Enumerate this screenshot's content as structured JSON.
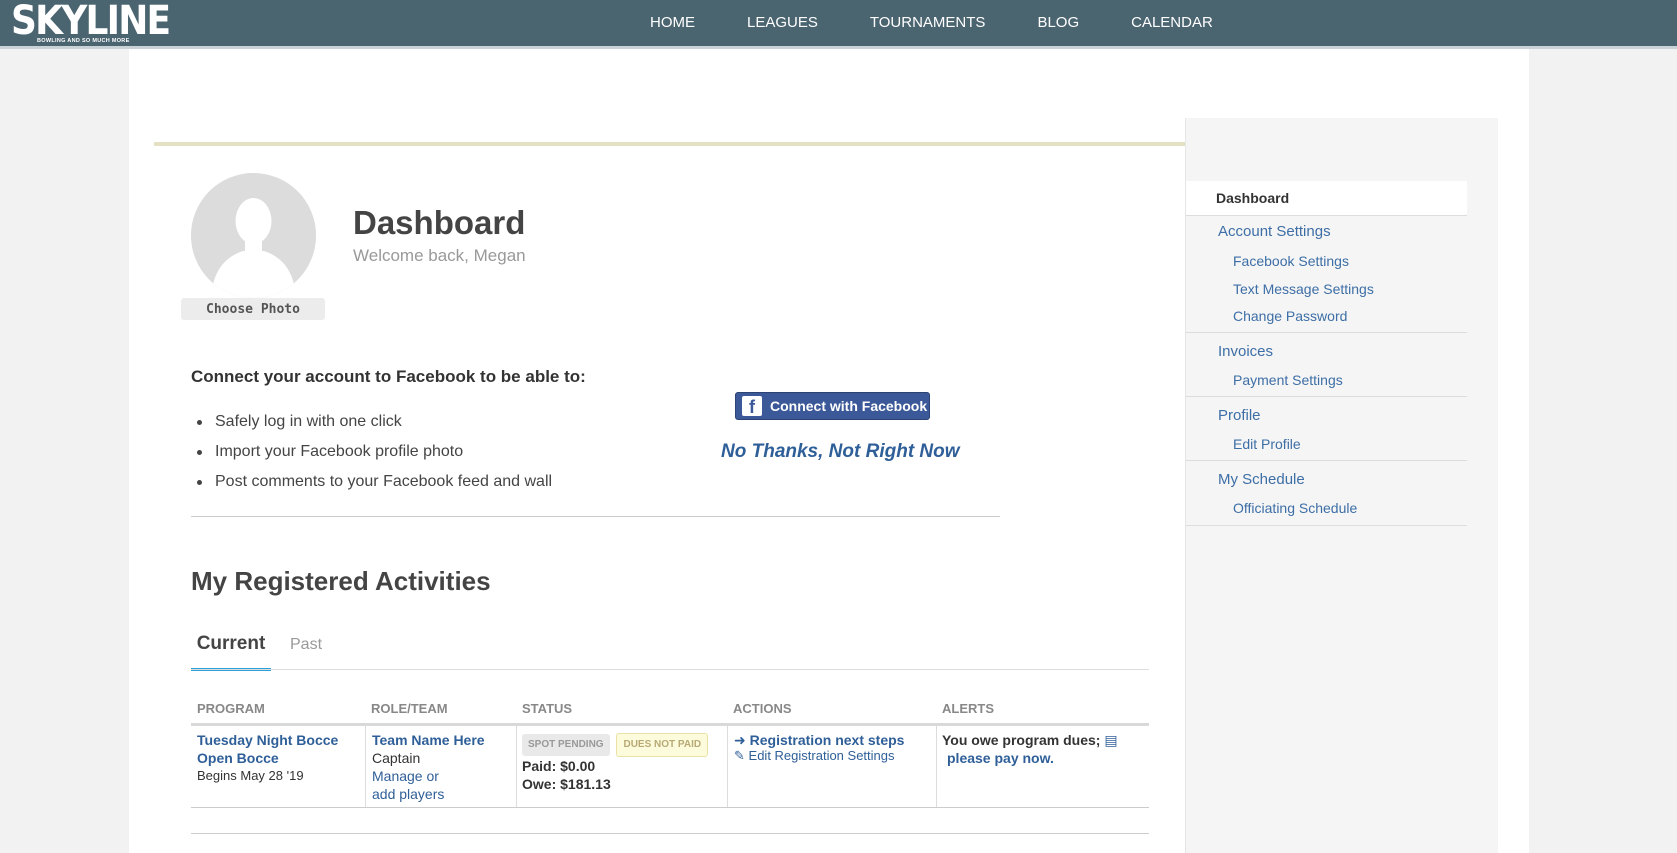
{
  "brand": {
    "name": "SKYLINE",
    "tagline": "BOWLING AND SO MUCH MORE"
  },
  "nav": [
    "HOME",
    "LEAGUES",
    "TOURNAMENTS",
    "BLOG",
    "CALENDAR"
  ],
  "profile": {
    "title": "Dashboard",
    "welcome": "Welcome back, Megan",
    "choose_photo": "Choose Photo"
  },
  "facebook": {
    "heading": "Connect your account to Facebook to be able to:",
    "benefits": [
      "Safely log in with one click",
      "Import your Facebook profile photo",
      "Post comments to your Facebook feed and wall"
    ],
    "connect_label": "Connect with Facebook",
    "icon": "facebook-icon",
    "no_thanks": "No Thanks, Not Right Now"
  },
  "activities": {
    "title": "My Registered Activities",
    "tabs": [
      {
        "label": "Current",
        "active": true
      },
      {
        "label": "Past",
        "active": false
      }
    ],
    "columns": [
      "PROGRAM",
      "ROLE/TEAM",
      "STATUS",
      "ACTIONS",
      "ALERTS"
    ],
    "rows": [
      {
        "program": {
          "name": "Tuesday Night Bocce",
          "sub": "Open Bocce",
          "begins": "Begins May 28 '19"
        },
        "team": {
          "name": "Team Name Here",
          "role": "Captain",
          "manage_1": "Manage or",
          "manage_2": "add players"
        },
        "status": {
          "badge_1": "SPOT PENDING",
          "badge_2": "DUES NOT PAID",
          "paid": "Paid: $0.00",
          "owe": "Owe: $181.13"
        },
        "actions": {
          "next_steps": "Registration next steps",
          "edit": "Edit Registration Settings"
        },
        "alerts": {
          "text": "You owe program dues;",
          "link": "please pay now."
        }
      }
    ]
  },
  "sidebar": {
    "active": "Dashboard",
    "groups": [
      {
        "label": "Account Settings",
        "items": [
          "Facebook Settings",
          "Text Message Settings",
          "Change Password"
        ]
      },
      {
        "label": "Invoices",
        "items": [
          "Payment Settings"
        ]
      },
      {
        "label": "Profile",
        "items": [
          "Edit Profile"
        ]
      },
      {
        "label": "My Schedule",
        "items": [
          "Officiating Schedule"
        ]
      }
    ]
  },
  "colors": {
    "header": "#4a6470",
    "link": "#2f5f98",
    "facebook": "#3b5998",
    "tab_active": "#2d9fd9"
  }
}
